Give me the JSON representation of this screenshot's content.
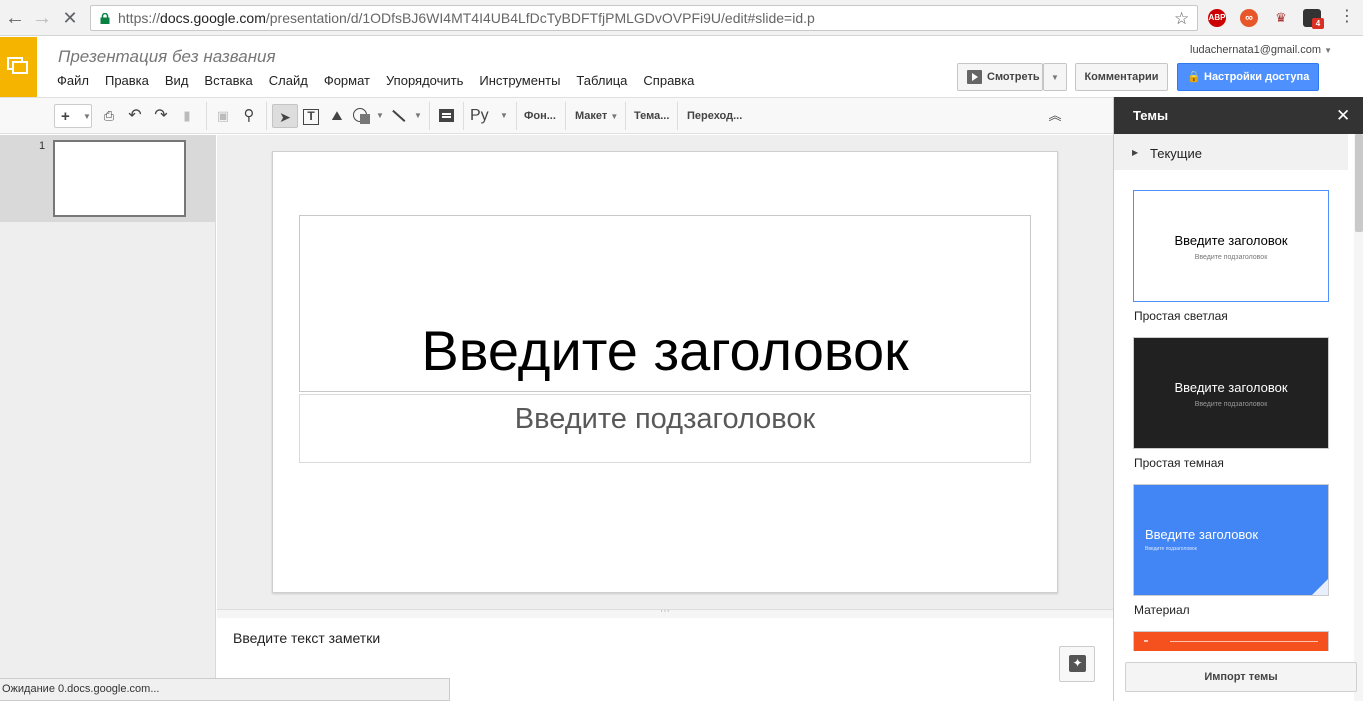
{
  "browser": {
    "url_scheme": "https://",
    "url_host": "docs.google.com",
    "url_path": "/presentation/d/1ODfsBJ6WI4MT4I4UB4LfDcTyBDFTfjPMLGDvOVPFi9U/edit#slide=id.p",
    "badge_count": "4",
    "abp_label": "ABP"
  },
  "app": {
    "doc_title": "Презентация без названия",
    "account": "ludachernata1@gmail.com",
    "menu": [
      "Файл",
      "Правка",
      "Вид",
      "Вставка",
      "Слайд",
      "Формат",
      "Упорядочить",
      "Инструменты",
      "Таблица",
      "Справка"
    ],
    "present_label": "Смотреть",
    "comments_label": "Комментарии",
    "share_label": "Настройки доступа"
  },
  "toolbar": {
    "input_tool_label": "Ру",
    "background_label": "Фон...",
    "layout_label": "Макет",
    "theme_label": "Тема...",
    "transition_label": "Переход..."
  },
  "filmstrip": {
    "slide_number": "1"
  },
  "slide": {
    "title_placeholder": "Введите заголовок",
    "subtitle_placeholder": "Введите подзаголовок"
  },
  "notes": {
    "placeholder": "Введите текст заметки"
  },
  "status": {
    "text": "Ожидание 0.docs.google.com..."
  },
  "themes_panel": {
    "title": "Темы",
    "current_label": "Текущие",
    "preview_title": "Введите заголовок",
    "preview_subtitle": "Введите подзаголовок",
    "themes": [
      {
        "name": "Простая светлая"
      },
      {
        "name": "Простая темная"
      },
      {
        "name": "Материал"
      }
    ],
    "import_label": "Импорт темы"
  },
  "colors": {
    "app_accent": "#f4b400",
    "share_blue": "#4d90fe",
    "material_blue": "#4285f4",
    "dark_theme": "#212121",
    "coral_theme": "#f4511e"
  }
}
